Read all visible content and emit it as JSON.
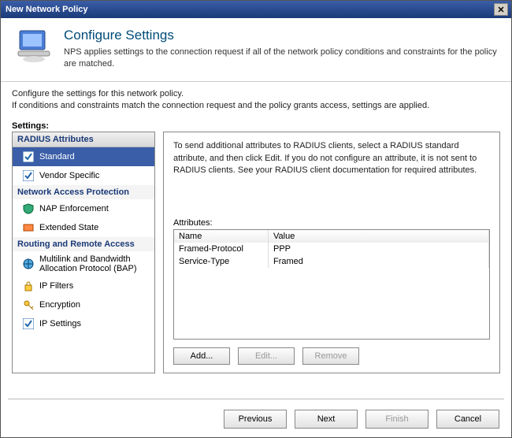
{
  "window": {
    "title": "New Network Policy"
  },
  "header": {
    "title": "Configure Settings",
    "subtext": "NPS applies settings to the connection request if all of the network policy conditions and constraints for the policy are matched."
  },
  "instructions": {
    "line1": "Configure the settings for this network policy.",
    "line2": "If conditions and constraints match the connection request and the policy grants access, settings are applied."
  },
  "sidebar_label": "Settings:",
  "sidebar": {
    "groups": [
      {
        "title": "RADIUS Attributes",
        "items": [
          {
            "label": "Standard",
            "icon": "check-icon",
            "selected": true
          },
          {
            "label": "Vendor Specific",
            "icon": "check-icon",
            "selected": false
          }
        ]
      },
      {
        "title": "Network Access Protection",
        "items": [
          {
            "label": "NAP Enforcement",
            "icon": "shield-icon",
            "selected": false
          },
          {
            "label": "Extended State",
            "icon": "state-icon",
            "selected": false
          }
        ]
      },
      {
        "title": "Routing and Remote Access",
        "items": [
          {
            "label": "Multilink and Bandwidth Allocation Protocol (BAP)",
            "icon": "globe-icon",
            "selected": false
          },
          {
            "label": "IP Filters",
            "icon": "lock-icon",
            "selected": false
          },
          {
            "label": "Encryption",
            "icon": "key-icon",
            "selected": false
          },
          {
            "label": "IP Settings",
            "icon": "check-icon",
            "selected": false
          }
        ]
      }
    ]
  },
  "pane": {
    "desc": "To send additional attributes to RADIUS clients, select a RADIUS standard attribute, and then click Edit. If you do not configure an attribute, it is not sent to RADIUS clients. See your RADIUS client documentation for required attributes.",
    "attributes_label": "Attributes:",
    "columns": {
      "name": "Name",
      "value": "Value"
    },
    "rows": [
      {
        "name": "Framed-Protocol",
        "value": "PPP"
      },
      {
        "name": "Service-Type",
        "value": "Framed"
      }
    ],
    "buttons": {
      "add": "Add...",
      "edit": "Edit...",
      "remove": "Remove"
    }
  },
  "footer": {
    "previous": "Previous",
    "next": "Next",
    "finish": "Finish",
    "cancel": "Cancel"
  }
}
